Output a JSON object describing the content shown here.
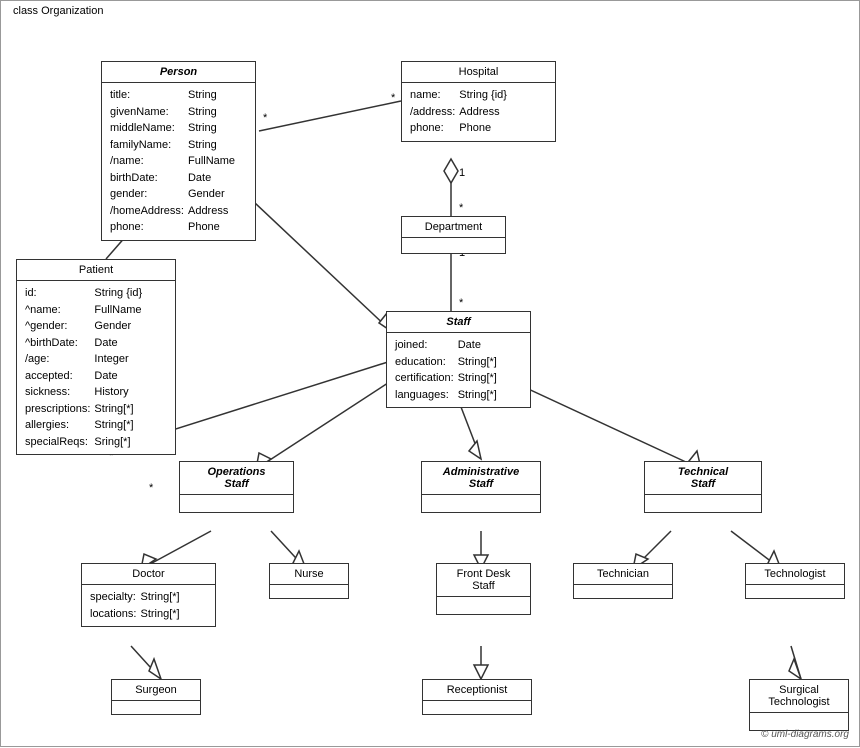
{
  "diagram": {
    "title": "class Organization",
    "classes": {
      "person": {
        "name": "Person",
        "italic": true,
        "attrs": [
          [
            "title:",
            "String"
          ],
          [
            "givenName:",
            "String"
          ],
          [
            "middleName:",
            "String"
          ],
          [
            "familyName:",
            "String"
          ],
          [
            "/name:",
            "FullName"
          ],
          [
            "birthDate:",
            "Date"
          ],
          [
            "gender:",
            "Gender"
          ],
          [
            "/homeAddress:",
            "Address"
          ],
          [
            "phone:",
            "Phone"
          ]
        ]
      },
      "hospital": {
        "name": "Hospital",
        "italic": false,
        "attrs": [
          [
            "name:",
            "String {id}"
          ],
          [
            "/address:",
            "Address"
          ],
          [
            "phone:",
            "Phone"
          ]
        ]
      },
      "patient": {
        "name": "Patient",
        "italic": false,
        "attrs": [
          [
            "id:",
            "String {id}"
          ],
          [
            "^name:",
            "FullName"
          ],
          [
            "^gender:",
            "Gender"
          ],
          [
            "^birthDate:",
            "Date"
          ],
          [
            "/age:",
            "Integer"
          ],
          [
            "accepted:",
            "Date"
          ],
          [
            "sickness:",
            "History"
          ],
          [
            "prescriptions:",
            "String[*]"
          ],
          [
            "allergies:",
            "String[*]"
          ],
          [
            "specialReqs:",
            "Sring[*]"
          ]
        ]
      },
      "department": {
        "name": "Department",
        "italic": false,
        "attrs": []
      },
      "staff": {
        "name": "Staff",
        "italic": true,
        "attrs": [
          [
            "joined:",
            "Date"
          ],
          [
            "education:",
            "String[*]"
          ],
          [
            "certification:",
            "String[*]"
          ],
          [
            "languages:",
            "String[*]"
          ]
        ]
      },
      "operations_staff": {
        "name": "Operations Staff",
        "italic": true,
        "attrs": []
      },
      "administrative_staff": {
        "name": "Administrative Staff",
        "italic": true,
        "attrs": []
      },
      "technical_staff": {
        "name": "Technical Staff",
        "italic": true,
        "attrs": []
      },
      "doctor": {
        "name": "Doctor",
        "italic": false,
        "attrs": [
          [
            "specialty:",
            "String[*]"
          ],
          [
            "locations:",
            "String[*]"
          ]
        ]
      },
      "nurse": {
        "name": "Nurse",
        "italic": false,
        "attrs": []
      },
      "front_desk_staff": {
        "name": "Front Desk Staff",
        "italic": false,
        "attrs": []
      },
      "technician": {
        "name": "Technician",
        "italic": false,
        "attrs": []
      },
      "technologist": {
        "name": "Technologist",
        "italic": false,
        "attrs": []
      },
      "surgeon": {
        "name": "Surgeon",
        "italic": false,
        "attrs": []
      },
      "receptionist": {
        "name": "Receptionist",
        "italic": false,
        "attrs": []
      },
      "surgical_technologist": {
        "name": "Surgical Technologist",
        "italic": false,
        "attrs": []
      }
    },
    "copyright": "© uml-diagrams.org"
  }
}
